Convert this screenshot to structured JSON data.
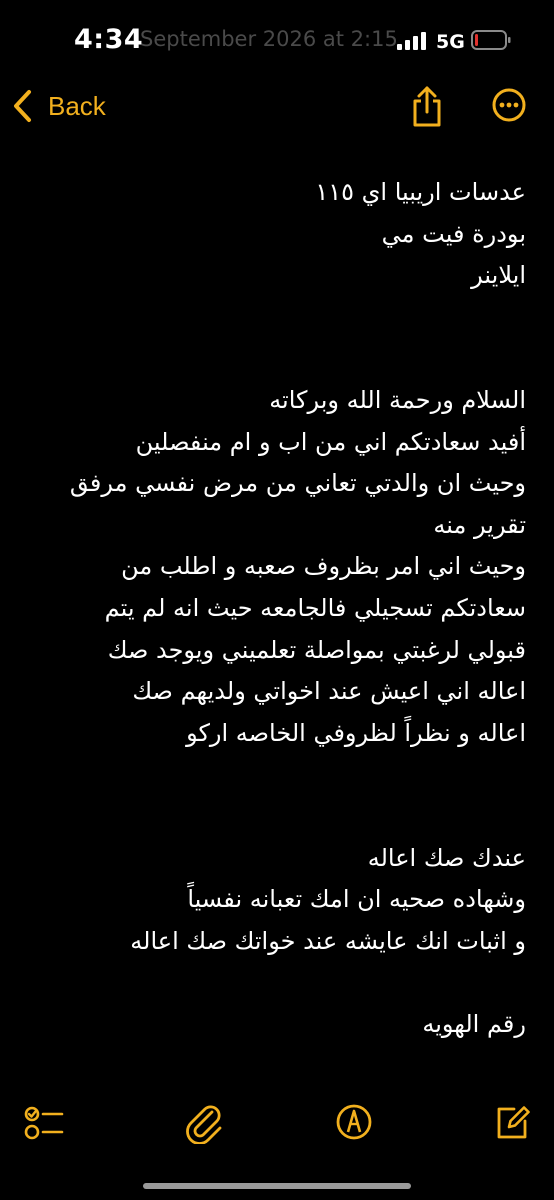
{
  "status_bar": {
    "time": "4:34",
    "ghost_text": "September 2026 at 2:15",
    "network": "5G",
    "signal_icon": "signal-bars-icon",
    "battery_icon": "battery-low-icon"
  },
  "nav": {
    "back_label": "Back",
    "share_icon": "share-icon",
    "more_icon": "more-ellipsis-icon",
    "accent_color": "#f2b01e"
  },
  "note": {
    "lines": [
      "عدسات اريبيا اي ١١٥",
      "بودرة فيت مي",
      "ايلاينر",
      "",
      "",
      "السلام ورحمة الله وبركاته",
      "أفيد سعادتكم اني من اب و ام منفصلين",
      "وحيث ان والدتي تعاني من مرض نفسي مرفق",
      "تقرير منه",
      "وحيث اني امر بظروف صعبه و اطلب من",
      "سعادتكم تسجيلي فالجامعه حيث انه لم يتم",
      "قبولي لرغبتي بمواصلة تعلميني ويوجد صك",
      "اعاله اني اعيش عند اخواتي ولديهم صك",
      "اعاله و نظراً لظروفي الخاصه اركو",
      "",
      "",
      "عندك صك اعاله",
      "وشهاده صحيه ان امك تعبانه نفسياً",
      "و اثبات انك عايشه عند خواتك صك اعاله",
      "",
      "رقم الهويه"
    ]
  },
  "toolbar": {
    "checklist_icon": "checklist-icon",
    "attach_icon": "paperclip-icon",
    "markup_icon": "markup-pen-icon",
    "compose_icon": "compose-icon"
  }
}
